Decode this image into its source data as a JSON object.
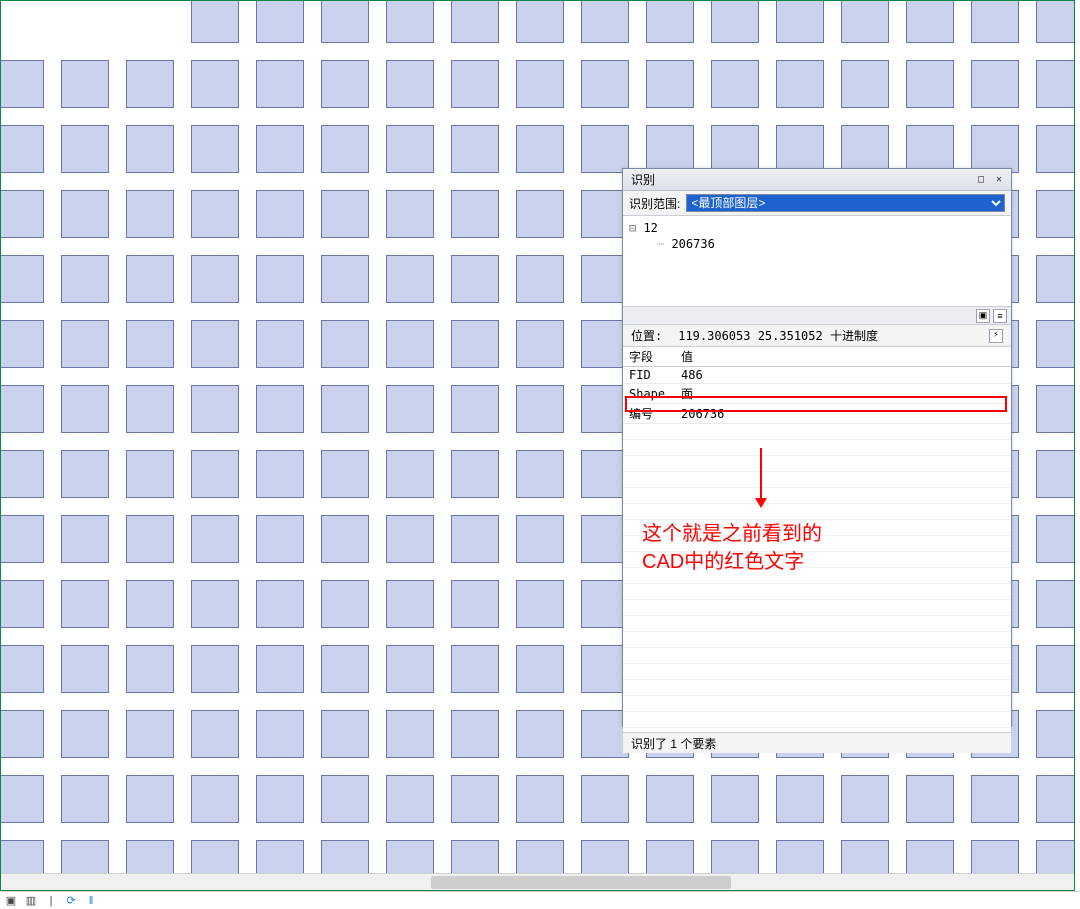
{
  "dialog": {
    "title": "识别",
    "scope_label": "识别范围:",
    "scope_value": "<最顶部图层>",
    "tree": {
      "root": "12",
      "child": "206736"
    },
    "position_label": "位置:",
    "position_value": "119.306053  25.351052 十进制度",
    "columns": {
      "field": "字段",
      "value": "值"
    },
    "rows": [
      {
        "field": "FID",
        "value": "486"
      },
      {
        "field": "Shape",
        "value": "面"
      },
      {
        "field": "编号",
        "value": "206736",
        "highlight": true
      }
    ],
    "status": "识别了 1 个要素"
  },
  "annotation": {
    "line1": "这个就是之前看到的",
    "line2": "CAD中的红色文字"
  },
  "statusbar": {
    "pause_icon": "‖"
  }
}
